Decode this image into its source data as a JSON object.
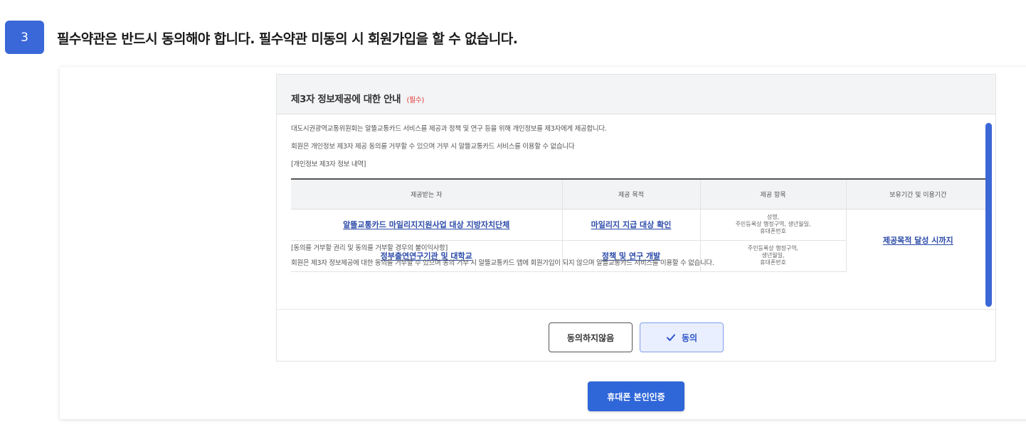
{
  "step": {
    "number": "3",
    "instruction": "필수약관은 반드시 동의해야 합니다. 필수약관 미동의 시 회원가입을 할 수 없습니다."
  },
  "modal": {
    "title": "제3자 정보제공에 대한 안내",
    "required_label": "(필수)",
    "intro_lines": [
      "대도시권광역교통위원회는 알뜰교통카드 서비스를 제공과 정책 및 연구 등을 위해 개인정보를 제3자에게 제공합니다.",
      "회원은 개인정보 제3자 제공 동의를 거부할 수 있으며 거부 시 알뜰교통카드 서비스를 이용할 수 없습니다",
      "[개인정보 제3자 정보 내역]"
    ],
    "table": {
      "headers": [
        "제공받는 자",
        "제공 목적",
        "제공 항목",
        "보유기간 및 이용기간"
      ],
      "rows": [
        {
          "recipient": "알뜰교통카드 마일리지지원사업 대상 지방자치단체",
          "purpose": "마일리지 지급 대상 확인",
          "items": [
            "성명,",
            "주민등록상 행정구역, 생년월일,",
            "휴대폰번호"
          ]
        },
        {
          "recipient": "정부출연연구기관 및 대학교",
          "purpose": "정책 및 연구 개발",
          "items": [
            "주민등록상 행정구역,",
            "생년월일,",
            "휴대폰번호"
          ]
        }
      ],
      "retention": "제공목적 달성 시까지"
    },
    "refusal_lines": [
      "[동의를 거부할 권리 및 동의를 거부할 경우의 불이익사항]",
      "회원은 제3자 정보제공에 대한 동의를 거부할 수 있으며 동의 거부 시 알뜰교통카드 앱에 회원가입이 되지 않으며 알뜰교통카드 서비스를 이용할 수 없습니다."
    ],
    "buttons": {
      "disagree": "동의하지않음",
      "agree": "동의"
    }
  },
  "verify_button": "휴대폰 본인인증",
  "colors": {
    "primary": "#2f66d8",
    "required": "#e53935",
    "link": "#2b4aa8"
  },
  "icons": {
    "agree": "check-icon"
  }
}
